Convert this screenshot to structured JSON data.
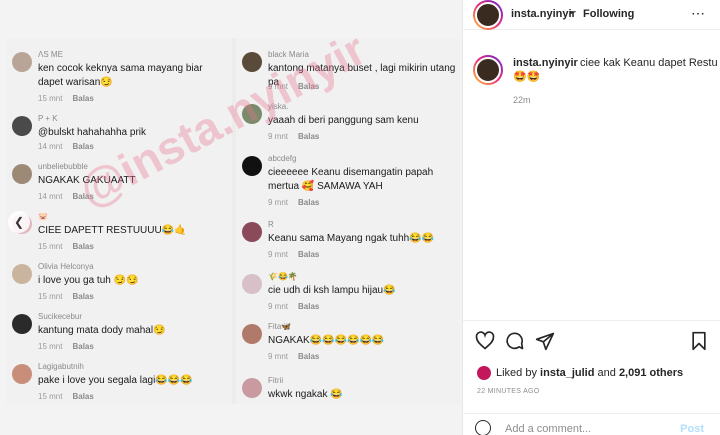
{
  "photo": {
    "watermark": "@insta.nyinyir",
    "left_comments": [
      {
        "user": "ΛS ME",
        "text": "ken cocok keknya sama mayang biar dapet warisan😏",
        "time": "15 mnt",
        "reply": "Balas"
      },
      {
        "user": "P + K",
        "text": "@bulskt hahahahha prik",
        "time": "14 mnt",
        "reply": "Balas"
      },
      {
        "user": "unbeliebubble",
        "text": "NGAKAK GAKUAATT",
        "time": "14 mnt",
        "reply": "Balas"
      },
      {
        "user": "🐷",
        "text": "CIEE DAPETT RESTUUUU😂🤙",
        "time": "15 mnt",
        "reply": "Balas"
      },
      {
        "user": "Olivia Helconya",
        "text": "i love you ga tuh 😏😏",
        "time": "15 mnt",
        "reply": "Balas"
      },
      {
        "user": "Sucikecebur",
        "text": "kantung mata dody mahal😏",
        "time": "15 mnt",
        "reply": "Balas"
      },
      {
        "user": "Lagigabutnih",
        "text": "pake i love you segala lagi😂😂😂",
        "time": "15 mnt",
        "reply": "Balas"
      }
    ],
    "right_comments": [
      {
        "user": "black Maria",
        "text": "kantong matanya buset , lagi mikirin utang pa",
        "time": "9 mnt",
        "reply": "Balas"
      },
      {
        "user": "yiska.",
        "text": "yaaah di beri panggung sam kenu",
        "time": "9 mnt",
        "reply": "Balas"
      },
      {
        "user": "abcdefg",
        "text": "cieeeeee Keanu disemangatin papah mertua 🥰 SAMAWA YAH",
        "time": "9 mnt",
        "reply": "Balas"
      },
      {
        "user": "R",
        "text": "Keanu sama Mayang ngak tuhh😂😂",
        "time": "9 mnt",
        "reply": "Balas"
      },
      {
        "user": "🌾😂🌴",
        "text": "cie udh di ksh lampu hijau😂",
        "time": "9 mnt",
        "reply": "Balas"
      },
      {
        "user": "Fita🦋",
        "text": "NGAKAK😂😂😂😂😂😂",
        "time": "9 mnt",
        "reply": "Balas"
      },
      {
        "user": "Fitrii",
        "text": "wkwk ngakak 😂",
        "time": "",
        "reply": ""
      }
    ]
  },
  "header": {
    "username": "insta.nyinyir",
    "separator": "•",
    "follow_label": "Following",
    "more_icon": "⋯"
  },
  "caption": {
    "username": "insta.nyinyir",
    "text": "ciee kak Keanu dapet Restu",
    "emoji": "🤩🤩",
    "time": "22m"
  },
  "actions": {
    "liked_prefix": "Liked by",
    "liked_user": "insta_julid",
    "liked_and": "and",
    "liked_count": "2,091 others",
    "ago": "22 MINUTES AGO",
    "add_placeholder": "Add a comment...",
    "post_label": "Post"
  }
}
